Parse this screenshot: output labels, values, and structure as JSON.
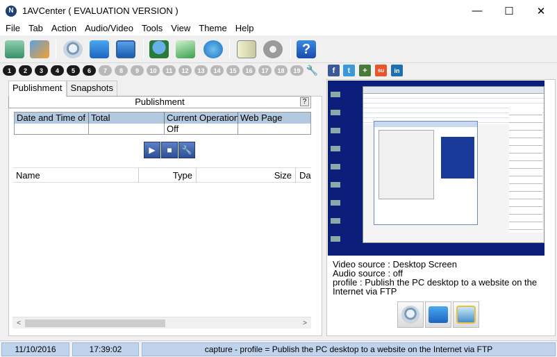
{
  "window": {
    "title": "1AVCenter ( EVALUATION VERSION )",
    "app_icon_letter": "N",
    "minimize_glyph": "—",
    "maximize_glyph": "☐",
    "close_glyph": "✕"
  },
  "menu": {
    "items": [
      "File",
      "Tab",
      "Action",
      "Audio/Video",
      "Tools",
      "View",
      "Theme",
      "Help"
    ]
  },
  "toolbar": {
    "buttons": [
      "storage-icon",
      "media-icon",
      "webcam-icon",
      "screens-icon",
      "monitor-icon",
      "publish-icon",
      "mail-icon",
      "globe-icon",
      "book-icon",
      "settings-icon",
      "help-icon"
    ]
  },
  "tabs_row": {
    "numbers": [
      "1",
      "2",
      "3",
      "4",
      "5",
      "6",
      "7",
      "8",
      "9",
      "10",
      "11",
      "12",
      "13",
      "14",
      "15",
      "16",
      "17",
      "18",
      "19"
    ],
    "social": [
      "f",
      "t",
      "+",
      "su",
      "in"
    ]
  },
  "left": {
    "tabs": [
      "Publishment",
      "Snapshots"
    ],
    "publishment_title": "Publishment",
    "help_label": "?",
    "table_headers": [
      "Date and Time of",
      "Total",
      "Current Operation",
      "Web Page"
    ],
    "table_row": [
      "",
      "",
      "Off",
      ""
    ],
    "list_headers": [
      "Name",
      "Type",
      "Size",
      "Da"
    ],
    "scroll_left": "<",
    "scroll_right": ">"
  },
  "right": {
    "video_source": "Video source : Desktop Screen",
    "audio_source": "Audio source : off",
    "profile_line1": "profile : Publish the PC desktop to a website on the",
    "profile_line2": "Internet via FTP"
  },
  "status": {
    "date": "11/10/2016",
    "time": "17:39:02",
    "message": "capture - profile =  Publish the PC desktop to a website on the Internet via FTP"
  },
  "colors": {
    "accent": "#1b3f7a",
    "table_header": "#b3c9e0",
    "status_cell": "#bfd3ec",
    "preview_bg": "#0b1f7a"
  }
}
